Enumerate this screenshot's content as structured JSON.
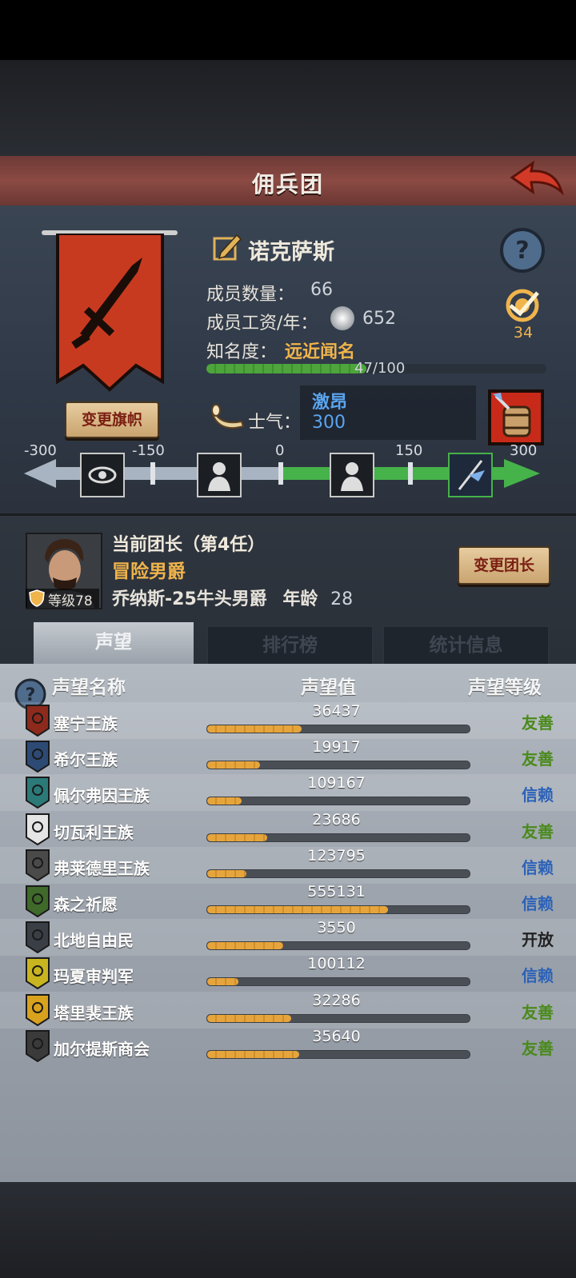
{
  "header": {
    "title": "佣兵团"
  },
  "guild": {
    "name": "诺克萨斯",
    "change_flag_label": "变更旗帜",
    "members_label": "成员数量：",
    "members_value": "66",
    "salary_label": "成员工资/年：",
    "salary_value": "652",
    "fame_label": "知名度：",
    "fame_value": "远近闻名",
    "fame_progress_text": "47/100",
    "fame_progress": 0.47,
    "rank_value": "34",
    "morale_label": "士气：",
    "morale_state": "激昂",
    "morale_value": "300"
  },
  "morale_scale": {
    "ticks": [
      "-300",
      "-150",
      "0",
      "150",
      "300"
    ],
    "value": 300
  },
  "leader": {
    "title": "当前团长（第4任）",
    "rank": "冒险男爵",
    "name_line": "乔纳斯-25牛头男爵",
    "age_label": "年龄",
    "age_value": "28",
    "level_label": "等级78",
    "change_leader_label": "变更团长"
  },
  "tabs": [
    {
      "label": "声望",
      "active": true
    },
    {
      "label": "排行榜",
      "active": false
    },
    {
      "label": "统计信息",
      "active": false
    }
  ],
  "reputation": {
    "col_name": "声望名称",
    "col_value": "声望值",
    "col_level": "声望等级",
    "rows": [
      {
        "name": "塞宁王族",
        "value": "36437",
        "level": "友善",
        "level_color": "#4a8a1c",
        "progress": 0.36,
        "icon_color": "#8e2a1c"
      },
      {
        "name": "希尔王族",
        "value": "19917",
        "level": "友善",
        "level_color": "#4a8a1c",
        "progress": 0.2,
        "icon_color": "#2d4a75"
      },
      {
        "name": "佩尔弗因王族",
        "value": "109167",
        "level": "信赖",
        "level_color": "#2c62b8",
        "progress": 0.13,
        "icon_color": "#2b7a78"
      },
      {
        "name": "切瓦利王族",
        "value": "23686",
        "level": "友善",
        "level_color": "#4a8a1c",
        "progress": 0.23,
        "icon_color": "#e5e5e5"
      },
      {
        "name": "弗莱德里王族",
        "value": "123795",
        "level": "信赖",
        "level_color": "#2c62b8",
        "progress": 0.15,
        "icon_color": "#4a4a4a"
      },
      {
        "name": "森之祈愿",
        "value": "555131",
        "level": "信赖",
        "level_color": "#2c62b8",
        "progress": 0.69,
        "icon_color": "#3f6a2a"
      },
      {
        "name": "北地自由民",
        "value": "3550",
        "level": "开放",
        "level_color": "#222222",
        "progress": 0.29,
        "icon_color": "#3a3f46"
      },
      {
        "name": "玛夏审判军",
        "value": "100112",
        "level": "信赖",
        "level_color": "#2c62b8",
        "progress": 0.12,
        "icon_color": "#c9b520"
      },
      {
        "name": "塔里裴王族",
        "value": "32286",
        "level": "友善",
        "level_color": "#4a8a1c",
        "progress": 0.32,
        "icon_color": "#d8a21e"
      },
      {
        "name": "加尔提斯商会",
        "value": "35640",
        "level": "友善",
        "level_color": "#4a8a1c",
        "progress": 0.35,
        "icon_color": "#3a3a3a"
      }
    ]
  }
}
